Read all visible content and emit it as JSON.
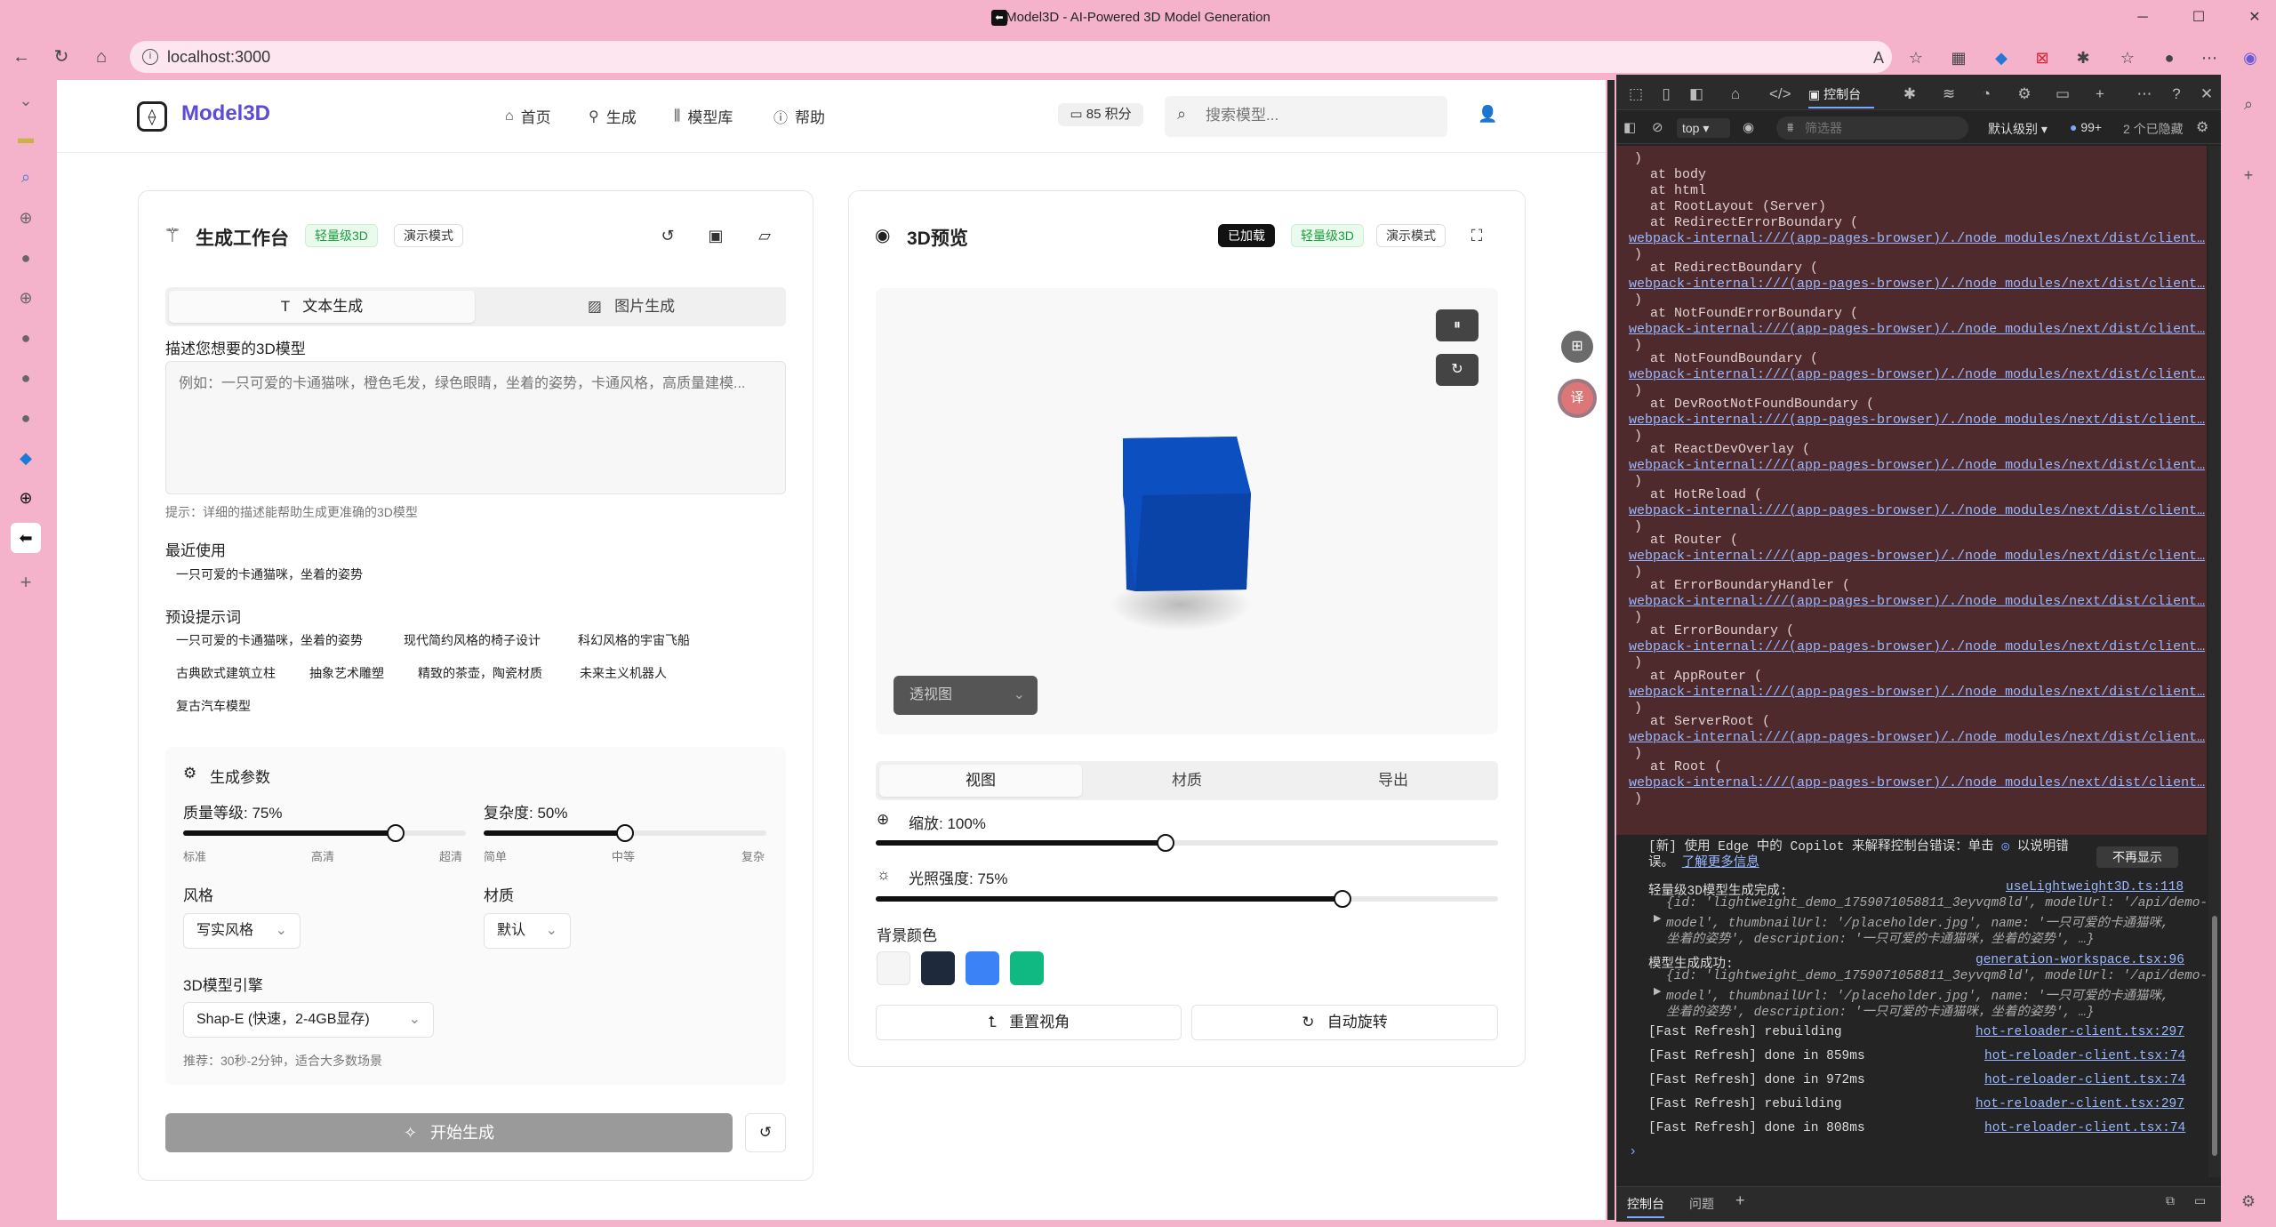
{
  "browser": {
    "window_title": "Model3D - AI-Powered 3D Model Generation",
    "url": "localhost:3000",
    "window_controls": {
      "minimize": "─",
      "maximize": "☐",
      "close": "✕"
    }
  },
  "nav": {
    "logo": "Model3D",
    "items": [
      {
        "label": "首页",
        "icon": "home-icon"
      },
      {
        "label": "生成",
        "icon": "wand-icon"
      },
      {
        "label": "模型库",
        "icon": "library-icon"
      },
      {
        "label": "帮助",
        "icon": "help-icon"
      }
    ],
    "credits": "85 积分",
    "search_placeholder": "搜索模型..."
  },
  "workspace": {
    "title": "生成工作台",
    "badge_lightweight": "轻量级3D",
    "badge_demo": "演示模式",
    "tabs": [
      "文本生成",
      "图片生成"
    ],
    "describe_label": "描述您想要的3D模型",
    "textarea_placeholder": "例如：一只可爱的卡通猫咪，橙色毛发，绿色眼睛，坐着的姿势，卡通风格，高质量建模...",
    "tip": "提示：详细的描述能帮助生成更准确的3D模型",
    "recent_label": "最近使用",
    "recent": [
      "一只可爱的卡通猫咪，坐着的姿势"
    ],
    "presets_label": "预设提示词",
    "presets_row1": [
      "一只可爱的卡通猫咪，坐着的姿势",
      "现代简约风格的椅子设计",
      "科幻风格的宇宙飞船"
    ],
    "presets_row2": [
      "古典欧式建筑立柱",
      "抽象艺术雕塑",
      "精致的茶壶，陶瓷材质",
      "未来主义机器人"
    ],
    "presets_row3": [
      "复古汽车模型"
    ],
    "params": {
      "title": "生成参数",
      "quality_label": "质量等级: 75%",
      "quality_value": 75,
      "quality_ticks": [
        "标准",
        "高清",
        "超清"
      ],
      "complexity_label": "复杂度: 50%",
      "complexity_value": 50,
      "complexity_ticks": [
        "简单",
        "中等",
        "复杂"
      ],
      "style_label": "风格",
      "style_value": "写实风格",
      "material_label": "材质",
      "material_value": "默认",
      "engine_label": "3D模型引擎",
      "engine_value": "Shap-E (快速，2-4GB显存)",
      "engine_hint": "推荐：30秒-2分钟，适合大多数场景"
    },
    "generate_button": "开始生成"
  },
  "preview": {
    "title": "3D预览",
    "badge_loaded": "已加载",
    "badge_lightweight": "轻量级3D",
    "badge_demo": "演示模式",
    "view_mode": "透视图",
    "tabs": [
      "视图",
      "材质",
      "导出"
    ],
    "zoom_label": "缩放: 100%",
    "zoom_value": 100,
    "light_label": "光照强度: 75%",
    "light_value": 75,
    "bg_label": "背景颜色",
    "bg_colors": [
      "#f5f5f5",
      "#1e293b",
      "#3b82f6",
      "#10b981"
    ],
    "cube_color": "#0b4fc0",
    "reset_button": "重置视角",
    "rotate_button": "自动旋转"
  },
  "devtools": {
    "active_tab": "控制台",
    "context": "top",
    "filter_placeholder": "筛选器",
    "level": "默认级别",
    "issues": "99+",
    "hidden": "2 个已隐藏",
    "stack": [
      {
        "text": "at body"
      },
      {
        "text": "at html"
      },
      {
        "text": "at RootLayout (Server)"
      },
      {
        "text": "at RedirectErrorBoundary (",
        "link": true
      },
      {
        "text": "at RedirectBoundary (",
        "link": true
      },
      {
        "text": "at NotFoundErrorBoundary (",
        "link": true
      },
      {
        "text": "at NotFoundBoundary (",
        "link": true
      },
      {
        "text": "at DevRootNotFoundBoundary (",
        "link": true
      },
      {
        "text": "at ReactDevOverlay (",
        "link": true
      },
      {
        "text": "at HotReload (",
        "link": true
      },
      {
        "text": "at Router (",
        "link": true
      },
      {
        "text": "at ErrorBoundaryHandler (",
        "link": true
      },
      {
        "text": "at ErrorBoundary (",
        "link": true
      },
      {
        "text": "at AppRouter (",
        "link": true
      },
      {
        "text": "at ServerRoot (",
        "link": true
      },
      {
        "text": "at Root (",
        "link": true
      }
    ],
    "stack_link": "webpack-internal:///(app-pages-browser)/./node_modules/next/dist/client…",
    "copilot_notice": "[新] 使用 Edge 中的 Copilot 来解释控制台错误：单击",
    "copilot_notice2": "以说明错误。",
    "learn_more": "了解更多信息",
    "dont_show": "不再显示",
    "logs": [
      {
        "msg": "轻量级3D模型生成完成:",
        "src": "useLightweight3D.ts:118",
        "obj1": "{id: 'lightweight_demo_1759071058811_3eyvqm8ld', modelUrl: '/api/demo-",
        "obj2": "model', thumbnailUrl: '/placeholder.jpg', name: '一只可爱的卡通猫咪,",
        "obj3": "坐着的姿势', description: '一只可爱的卡通猫咪，坐着的姿势', …}"
      },
      {
        "msg": "模型生成成功:",
        "src": "generation-workspace.tsx:96",
        "obj1": "{id: 'lightweight_demo_1759071058811_3eyvqm8ld', modelUrl: '/api/demo-",
        "obj2": "model', thumbnailUrl: '/placeholder.jpg', name: '一只可爱的卡通猫咪,",
        "obj3": "坐着的姿势', description: '一只可爱的卡通猫咪，坐着的姿势', …}"
      }
    ],
    "refresh": [
      {
        "msg": "[Fast Refresh] rebuilding",
        "src": "hot-reloader-client.tsx:297"
      },
      {
        "msg": "[Fast Refresh] done in 859ms",
        "src": "hot-reloader-client.tsx:74"
      },
      {
        "msg": "[Fast Refresh] done in 972ms",
        "src": "hot-reloader-client.tsx:74"
      },
      {
        "msg": "[Fast Refresh] rebuilding",
        "src": "hot-reloader-client.tsx:297"
      },
      {
        "msg": "[Fast Refresh] done in 808ms",
        "src": "hot-reloader-client.tsx:74"
      }
    ],
    "bottom_tabs": [
      "控制台",
      "问题"
    ]
  }
}
